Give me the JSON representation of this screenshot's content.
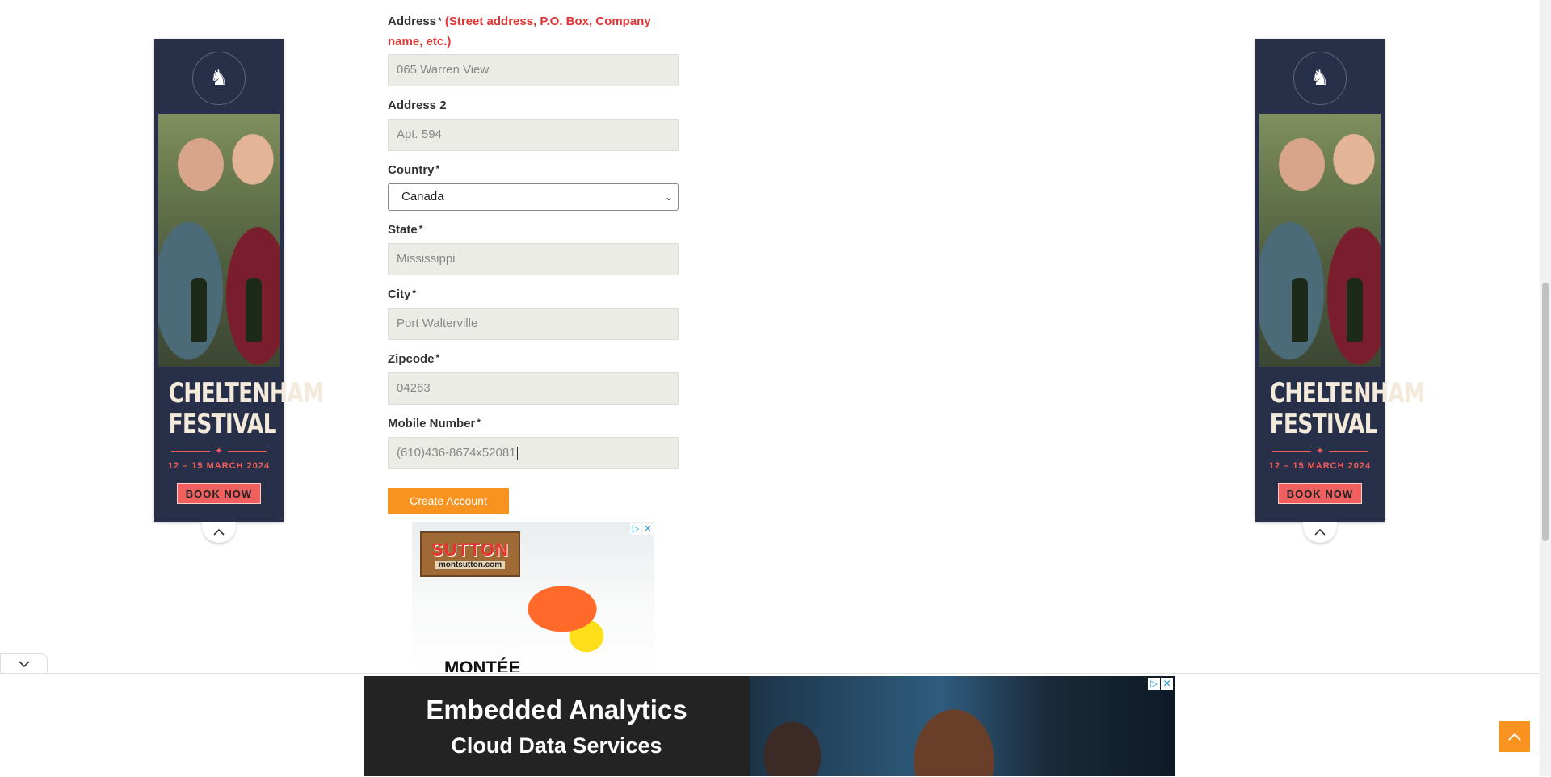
{
  "form": {
    "address_label": "Address",
    "address_hint": "(Street address, P.O. Box, Company name, etc.)",
    "address_value": "065 Warren View",
    "address2_label": "Address 2",
    "address2_value": "Apt. 594",
    "country_label": "Country",
    "country_value": "Canada",
    "state_label": "State",
    "state_value": "Mississippi",
    "city_label": "City",
    "city_value": "Port Walterville",
    "zip_label": "Zipcode",
    "zip_value": "04263",
    "mobile_label": "Mobile Number",
    "mobile_value": "(610)436-8674x52081",
    "required_mark": "*",
    "submit_label": "Create Account"
  },
  "side_ad": {
    "logo_text": "CHELTENHAM FESTIVAL",
    "title_line1": "CHELTENHAM",
    "title_line2": "FESTIVAL",
    "dates": "12 – 15 MARCH 2024",
    "cta": "BOOK NOW",
    "colors": {
      "bg": "#283049",
      "accent": "#f15f5f"
    }
  },
  "inline_ad": {
    "brand": "SUTTON",
    "site": "montsutton.com",
    "bottom_text": "MONTÉE",
    "adchoices_icon": "adchoices-icon",
    "close_icon": "close-icon"
  },
  "bottom_ad": {
    "line1": "Embedded Analytics",
    "line2": "Cloud Data Services",
    "adchoices_icon": "adchoices-icon",
    "close_icon": "close-icon"
  },
  "icons": {
    "collapse": "chevron-up-icon",
    "expand": "chevron-down-icon",
    "scroll_top": "arrow-up-icon"
  },
  "colors": {
    "accent": "#f7931e",
    "hint_red": "#e23434"
  }
}
